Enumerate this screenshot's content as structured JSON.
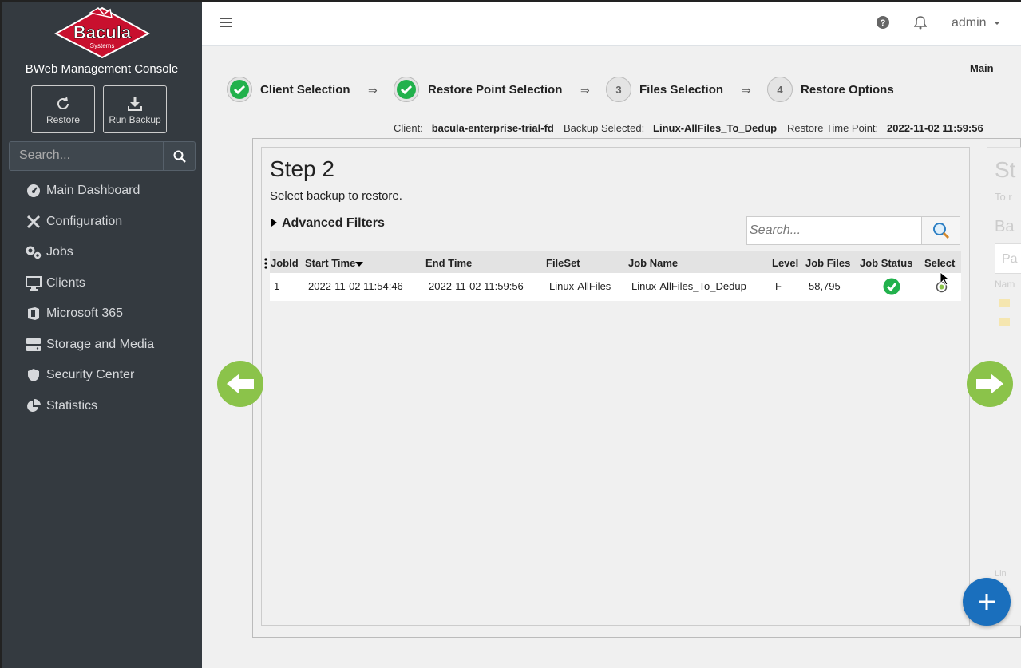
{
  "sidebar": {
    "logo_text": "Bacula",
    "logo_subtext": "Systems",
    "console_title": "BWeb Management Console",
    "quick_buttons": [
      {
        "label": "Restore"
      },
      {
        "label": "Run Backup"
      }
    ],
    "search_placeholder": "Search...",
    "items": [
      {
        "label": "Main Dashboard",
        "icon": "dashboard-icon"
      },
      {
        "label": "Configuration",
        "icon": "tools-icon"
      },
      {
        "label": "Jobs",
        "icon": "gears-icon"
      },
      {
        "label": "Clients",
        "icon": "monitor-icon"
      },
      {
        "label": "Microsoft 365",
        "icon": "office-icon"
      },
      {
        "label": "Storage and Media",
        "icon": "storage-icon"
      },
      {
        "label": "Security Center",
        "icon": "shield-icon"
      },
      {
        "label": "Statistics",
        "icon": "pie-chart-icon"
      }
    ]
  },
  "topbar": {
    "user": "admin"
  },
  "breadcrumb": "Main",
  "wizard": {
    "steps": [
      {
        "label": "Client Selection",
        "state": "done"
      },
      {
        "label": "Restore Point Selection",
        "state": "done"
      },
      {
        "label": "Files Selection",
        "state": "pending",
        "number": "3"
      },
      {
        "label": "Restore Options",
        "state": "pending",
        "number": "4"
      }
    ],
    "arrow": "⇒"
  },
  "info": {
    "client_label": "Client:",
    "client_value": "bacula-enterprise-trial-fd",
    "backup_label": "Backup Selected:",
    "backup_value": "Linux-AllFiles_To_Dedup",
    "time_label": "Restore Time Point:",
    "time_value": "2022-11-02 11:59:56"
  },
  "step": {
    "title": "Step 2",
    "description": "Select backup to restore.",
    "advanced_filters": "Advanced Filters",
    "search_placeholder": "Search..."
  },
  "next_card": {
    "title_fragment": "St",
    "desc_fragment": "To r",
    "sub_fragment": "Ba",
    "input_fragment": "Pa",
    "col_fragment": "Nam",
    "footer_fragment": "Lin"
  },
  "table": {
    "headers": [
      "JobId",
      "Start Time",
      "End Time",
      "FileSet",
      "Job Name",
      "Level",
      "Job Files",
      "Job Status",
      "Select"
    ],
    "rows": [
      {
        "jobid": "1",
        "start": "2022-11-02 11:54:46",
        "end": "2022-11-02 11:59:56",
        "fileset": "Linux-AllFiles",
        "jobname": "Linux-AllFiles_To_Dedup",
        "level": "F",
        "files": "58,795",
        "status": "ok"
      }
    ]
  },
  "colors": {
    "sidebar_bg": "#343a40",
    "success": "#22b14c",
    "nav_arrow": "#8bc34a",
    "fab": "#1a6fbd"
  }
}
